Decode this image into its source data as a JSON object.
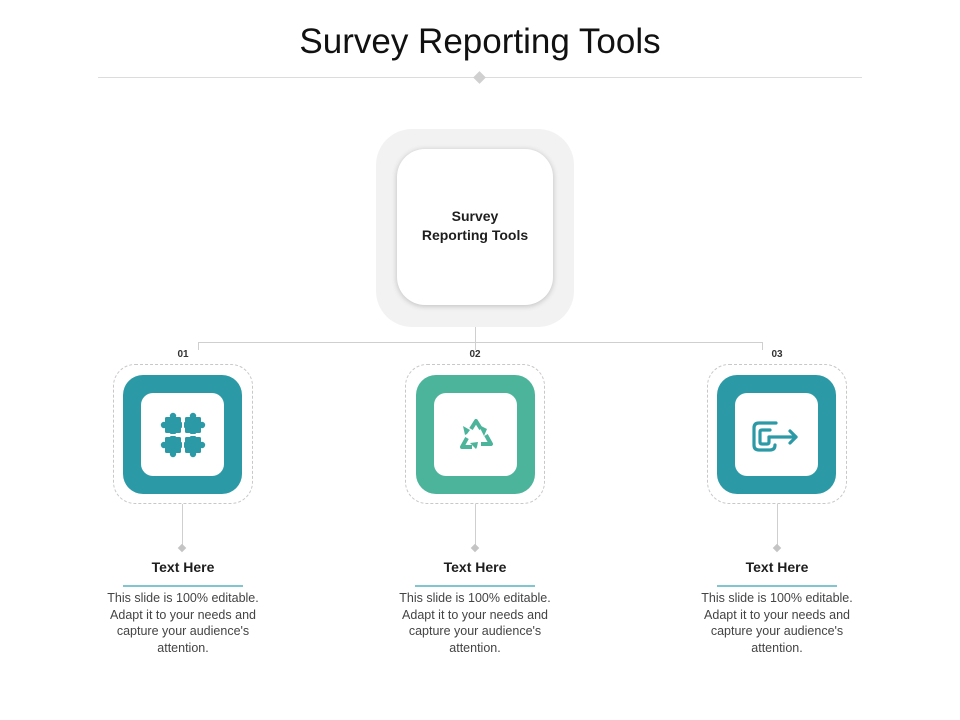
{
  "title": "Survey Reporting Tools",
  "hub": {
    "label": "Survey\nReporting Tools"
  },
  "colors": {
    "teal_dark": "#2b9aa6",
    "teal_light": "#4cb49a",
    "connector": "#cfcfcf",
    "rule": "#7fc6d0"
  },
  "items": [
    {
      "number": "01",
      "title": "Text Here",
      "description": "This slide is 100% editable. Adapt it to your needs and capture your audience's attention.",
      "icon": "puzzle-icon"
    },
    {
      "number": "02",
      "title": "Text Here",
      "description": "This slide is 100% editable. Adapt it to your needs and capture your audience's attention.",
      "icon": "recycle-icon"
    },
    {
      "number": "03",
      "title": "Text Here",
      "description": "This slide is 100% editable. Adapt it to your needs and capture your audience's attention.",
      "icon": "export-icon"
    }
  ]
}
